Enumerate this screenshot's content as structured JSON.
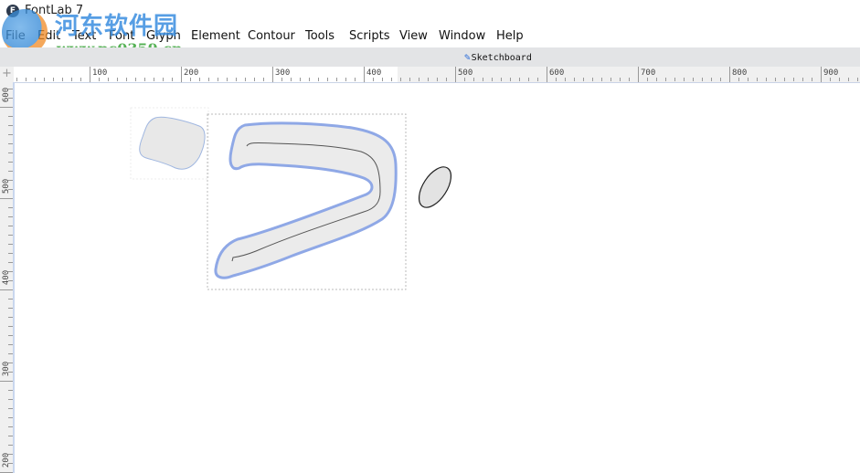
{
  "window": {
    "title": "FontLab 7",
    "app_icon": "fontlab-app-icon"
  },
  "watermark": {
    "text_cn": "河东软件园",
    "url": "www.pc0359.cn"
  },
  "menu": {
    "items": [
      {
        "label": "File"
      },
      {
        "label": "Edit"
      },
      {
        "label": "Text"
      },
      {
        "label": "Font"
      },
      {
        "label": "Glyph"
      },
      {
        "label": "Element"
      },
      {
        "label": "Contour"
      },
      {
        "label": "Tools"
      },
      {
        "label": "Scripts"
      },
      {
        "label": "View"
      },
      {
        "label": "Window"
      },
      {
        "label": "Help"
      }
    ]
  },
  "tab": {
    "label": "Sketchboard",
    "icon": "pen-icon",
    "icon_color": "#2a6cd8"
  },
  "rulers": {
    "horizontal_labels": [
      "100",
      "200",
      "300",
      "400",
      "500",
      "600",
      "700",
      "800",
      "900"
    ],
    "vertical_labels": [
      "600",
      "500",
      "400",
      "300",
      "200"
    ]
  },
  "canvas": {
    "shapes": [
      {
        "name": "blob-shape",
        "fill": "#e8e8e8",
        "stroke": "#9fb6e0"
      },
      {
        "name": "stroke-glyph-shape",
        "fill": "#ebebeb",
        "stroke": "#8fa8e6",
        "spine": "#555555"
      },
      {
        "name": "ellipse-shape",
        "fill": "#e3e3e3",
        "stroke": "#222222"
      }
    ],
    "selection_color": "#bbbbbb"
  }
}
